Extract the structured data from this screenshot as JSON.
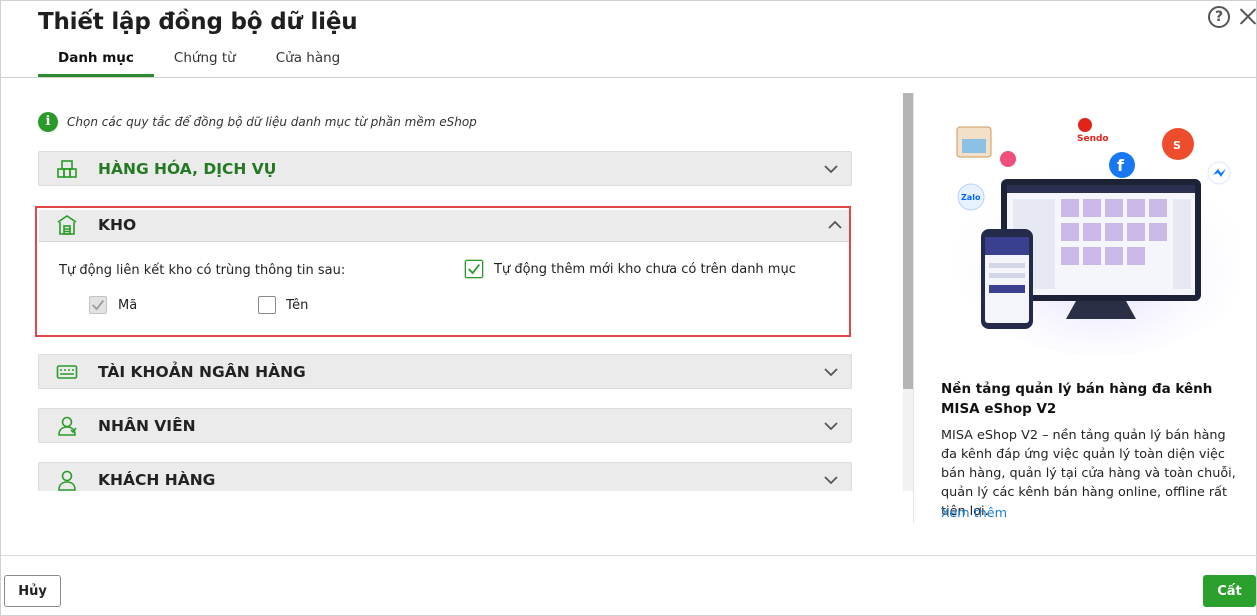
{
  "dialog": {
    "title": "Thiết lập đồng bộ dữ liệu",
    "help_icon": "question-circle-icon",
    "close_icon": "close-icon"
  },
  "tabs": [
    {
      "label": "Danh mục",
      "active": true
    },
    {
      "label": "Chứng từ",
      "active": false
    },
    {
      "label": "Cửa hàng",
      "active": false
    }
  ],
  "info_text": "Chọn các quy tắc để đồng bộ dữ liệu danh mục từ phần mềm eShop",
  "sections": {
    "hang_hoa": {
      "label": "HÀNG HÓA, DỊCH VỤ",
      "icon": "boxes-icon",
      "expanded": false
    },
    "kho": {
      "label": "KHO",
      "icon": "warehouse-icon",
      "expanded": true,
      "auto_link_label": "Tự động liên kết kho có trùng thông tin sau:",
      "auto_add_label": "Tự động thêm mới kho chưa có trên danh mục",
      "auto_add_checked": true,
      "code_label": "Mã",
      "code_checked": true,
      "name_label": "Tên",
      "name_checked": false
    },
    "tai_khoan": {
      "label": "TÀI KHOẢN NGÂN HÀNG",
      "icon": "bank-card-icon",
      "expanded": false
    },
    "nhan_vien": {
      "label": "NHÂN VIÊN",
      "icon": "employee-icon",
      "expanded": false
    },
    "khach_hang": {
      "label": "KHÁCH HÀNG",
      "icon": "customer-icon",
      "expanded": false
    }
  },
  "promo": {
    "badges": [
      "Sendo",
      "Zalo",
      "S"
    ],
    "title": "Nền tảng quản lý bán hàng đa kênh MISA eShop V2",
    "description": "MISA eShop V2 – nền tảng quản lý bán hàng đa kênh đáp ứng việc quản lý toàn diện việc bán hàng, quản lý tại cửa hàng và toàn chuỗi, quản lý các kênh bán hàng online, offline rất tiện lợi.",
    "link": "Xem thêm"
  },
  "footer": {
    "cancel_label": "Hủy",
    "save_label": "Cất"
  },
  "colors": {
    "accent_green": "#2ca02c",
    "highlight_red": "#e04848",
    "link_blue": "#1a7fd1"
  }
}
